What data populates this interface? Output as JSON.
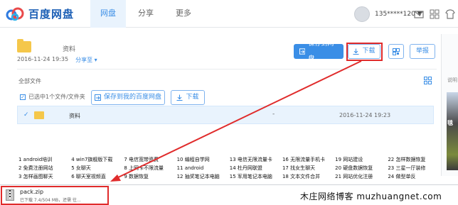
{
  "header": {
    "logo_text": "百度网盘",
    "nav": [
      "网盘",
      "分享",
      "更多"
    ],
    "username": "135*****120 ▼"
  },
  "file_detail": {
    "name": "资料",
    "date": "2016-11-24 19:35",
    "share_label": "分享至 ▾",
    "save_button": "保存到网盘",
    "download_button": "下载",
    "report_button": "举报"
  },
  "list": {
    "all_files": "全部文件",
    "selected_text": "已选中1个文件/文件夹",
    "save_to_mine": "保存到我的百度网盘",
    "download": "下载",
    "rows": [
      {
        "name": "资料",
        "size": "-",
        "date": "2016-11-24 19:23"
      }
    ]
  },
  "sidebar": {
    "label": "说明",
    "ad_text": "毯"
  },
  "links": [
    "1 android培训",
    "4 win7旗舰版下载",
    "7 电信宽带资费",
    "10 编程自学网",
    "13 电信无限流量卡",
    "16 无限流量手机卡",
    "19 网站建设",
    "22 怎样数据恢复",
    "2 免费注册网站",
    "5 女聊天",
    "8 上网卡不限流量",
    "11 android",
    "14 杜丹网联盟",
    "17 找女生聊天",
    "20 硬盘数据恢复",
    "23 三星一厅装修",
    "3 怎样画图聊天",
    "6 聊天室视频直",
    "9 数据恢复",
    "12 抽奖笔记本电脑",
    "15 军用笔记本电脑",
    "18 文本文件合并",
    "21 网站优化注册",
    "24 做型单反"
  ],
  "download_bar": {
    "file_name": "pack.zip",
    "status": "已下载 7.4/504 MB，还需 往..."
  },
  "watermark": "木庄网络博客 muzhuangnet.com",
  "colors": {
    "accent": "#3a8ee6",
    "highlight": "#e02b2b",
    "folder": "#f5c74a"
  }
}
